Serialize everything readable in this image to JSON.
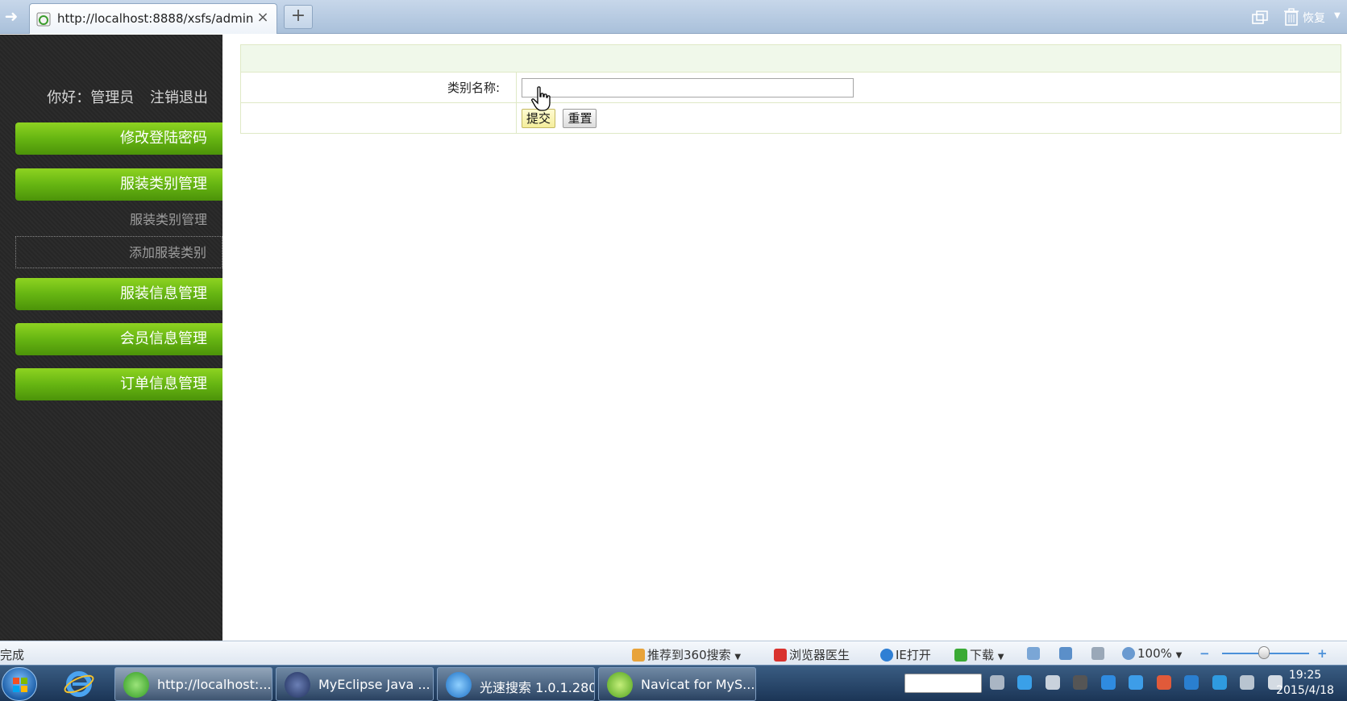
{
  "browser": {
    "tab_title": "http://localhost:8888/xsfs/admin...",
    "close_glyph": "×",
    "new_tab_glyph": "+",
    "restore_label": "恢复"
  },
  "sidebar": {
    "greeting_user": "你好：管理员",
    "logout": "注销退出",
    "menu": [
      {
        "label": "修改登陆密码"
      },
      {
        "label": "服装类别管理"
      },
      {
        "label": "服装信息管理"
      },
      {
        "label": "会员信息管理"
      },
      {
        "label": "订单信息管理"
      }
    ],
    "submenu": [
      {
        "label": "服装类别管理"
      },
      {
        "label": "添加服装类别"
      }
    ]
  },
  "form": {
    "category_label": "类别名称:",
    "category_value": "",
    "submit_label": "提交",
    "reset_label": "重置"
  },
  "statusbar": {
    "status": "完成",
    "recommend": "推荐到360搜索",
    "doctor": "浏览器医生",
    "ie_open": "IE打开",
    "download": "下载",
    "zoom": "100%",
    "zoom_minus": "−",
    "zoom_plus": "+"
  },
  "taskbar": {
    "tasks": [
      {
        "label": "http://localhost:..."
      },
      {
        "label": "MyEclipse Java ..."
      },
      {
        "label": "光速搜索 1.0.1.280"
      },
      {
        "label": "Navicat for MyS..."
      }
    ],
    "clock_time": "19:25",
    "clock_date": "2015/4/18"
  },
  "colors": {
    "menu_green": "#66b512",
    "sidebar_bg": "#2a2a2a",
    "form_border": "#dfe9c6"
  }
}
